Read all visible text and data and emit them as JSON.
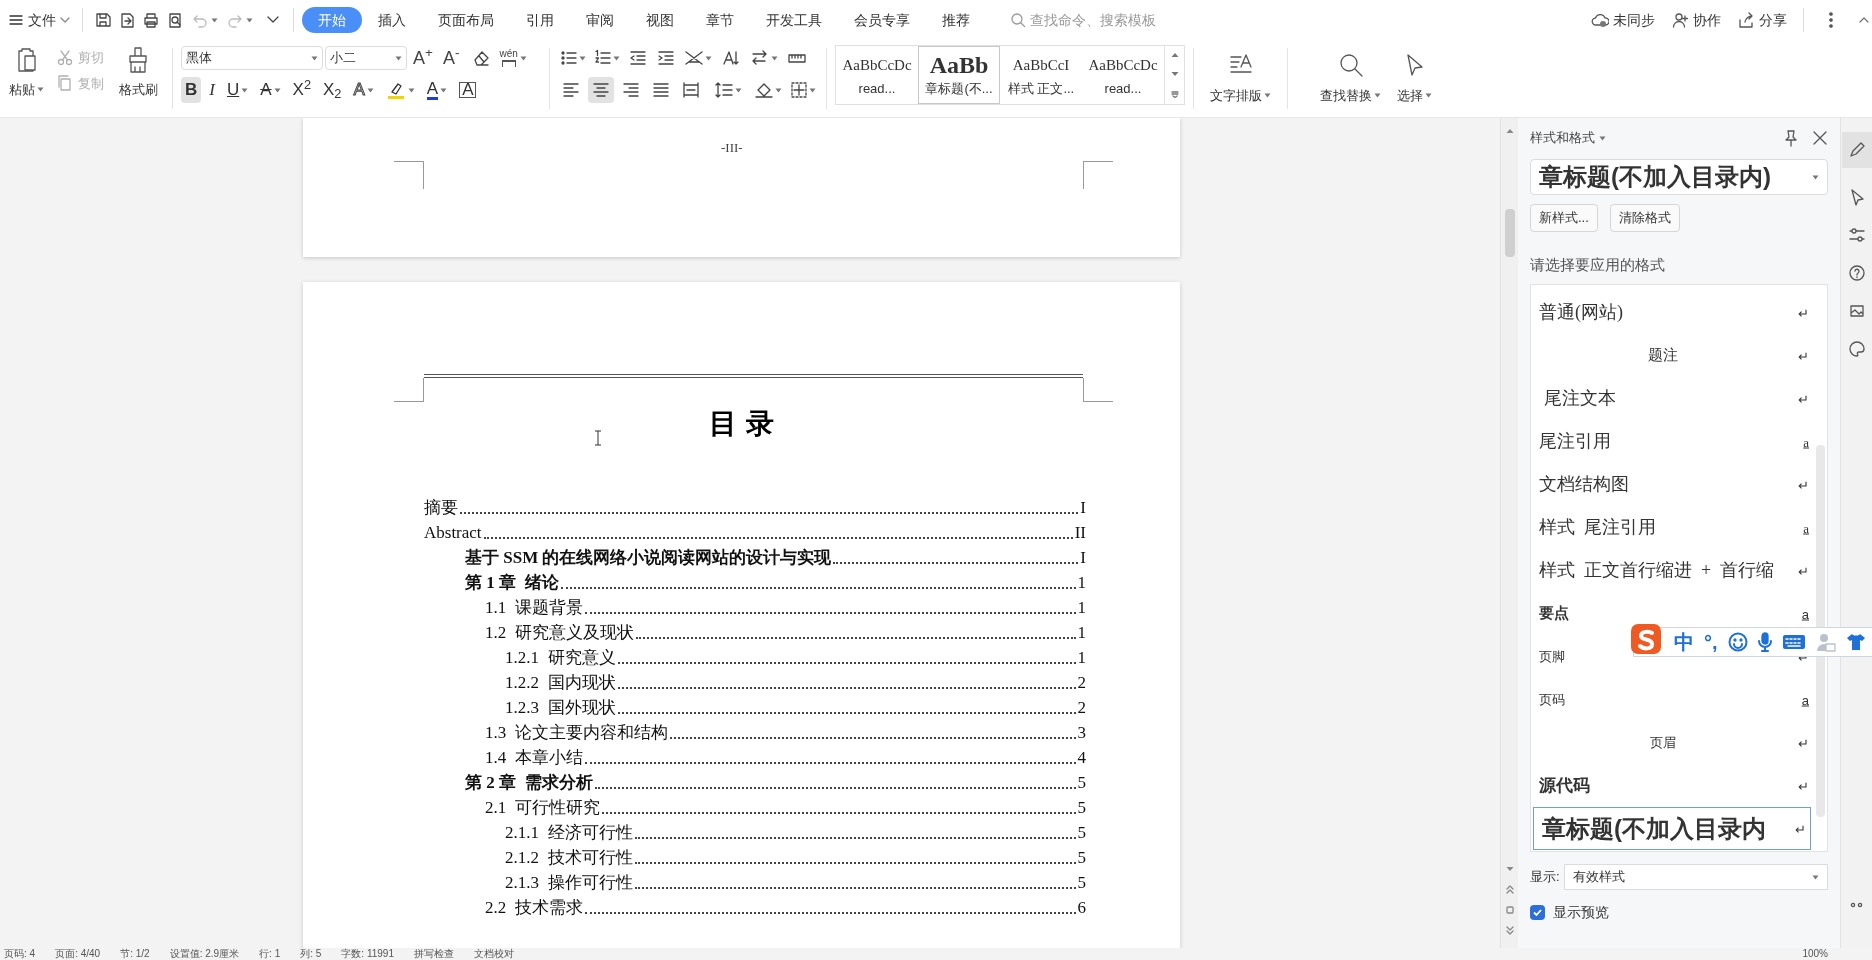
{
  "title_bar": {
    "file_menu": "文件",
    "tabs": [
      {
        "label": "开始",
        "selected": true
      },
      {
        "label": "插入",
        "selected": false
      },
      {
        "label": "页面布局",
        "selected": false
      },
      {
        "label": "引用",
        "selected": false
      },
      {
        "label": "审阅",
        "selected": false
      },
      {
        "label": "视图",
        "selected": false
      },
      {
        "label": "章节",
        "selected": false
      },
      {
        "label": "开发工具",
        "selected": false
      },
      {
        "label": "会员专享",
        "selected": false
      },
      {
        "label": "推荐",
        "selected": false
      }
    ],
    "search": {
      "placeholder": "查找命令、搜索模板"
    },
    "actions": [
      {
        "label": "未同步",
        "kind": "cloud"
      },
      {
        "label": "协作",
        "kind": "user"
      },
      {
        "label": "分享",
        "kind": "share"
      }
    ]
  },
  "ribbon": {
    "paste": "粘贴",
    "cut": {
      "label": "剪切",
      "disabled": true
    },
    "copy": {
      "label": "复制",
      "disabled": true
    },
    "format_painter": "格式刷",
    "font": {
      "name": "黑体",
      "size": "小二"
    },
    "font_tools": [
      {
        "glyph": "A$^{+}$",
        "kind": "grow"
      },
      {
        "glyph": "A$^{-}$",
        "kind": "shrink"
      },
      {
        "kind": "eraser"
      },
      {
        "glyph": "wén",
        "kind": "phonetic"
      }
    ],
    "format_buttons": [
      {
        "glyph": "B",
        "kind": "bold",
        "caret": false,
        "selected": true
      },
      {
        "glyph": "I",
        "kind": "italic",
        "caret": false,
        "selected": false
      },
      {
        "glyph": "U",
        "kind": "underline",
        "caret": true,
        "selected": false
      },
      {
        "glyph": "A",
        "kind": "strike",
        "caret": true,
        "selected": false
      },
      {
        "glyph": "X$^{2}$",
        "kind": "plain",
        "caret": false,
        "selected": false
      },
      {
        "glyph": "X$_{2}$",
        "kind": "plain",
        "caret": false,
        "selected": false
      },
      {
        "glyph": "A",
        "kind": "outline",
        "caret": true,
        "selected": false
      },
      {
        "kind": "highlight",
        "caret": true,
        "selected": false
      },
      {
        "glyph": "A",
        "kind": "color",
        "caret": true,
        "selected": false
      },
      {
        "glyph": "A",
        "kind": "boxed",
        "caret": false,
        "selected": false
      }
    ],
    "align_buttons": [
      {
        "kind": "left",
        "selected": false
      },
      {
        "kind": "center",
        "selected": true
      },
      {
        "kind": "right",
        "selected": false
      },
      {
        "kind": "justify",
        "selected": false
      },
      {
        "kind": "distributed",
        "selected": false
      }
    ],
    "styles": [
      {
        "sample": "AaBbCcDc",
        "name": "read...",
        "kind": "plain",
        "selected": false
      },
      {
        "sample": "AaBb",
        "name": "章标题(不...",
        "kind": "bold",
        "selected": true
      },
      {
        "sample": "AaBbCcI",
        "name": "样式 正文...",
        "kind": "plain",
        "selected": false
      },
      {
        "sample": "AaBbCcDc",
        "name": "read...",
        "kind": "plain",
        "selected": false
      }
    ],
    "tools": [
      {
        "label": "文字排版",
        "kind": "layout"
      },
      {
        "label": "查找替换",
        "kind": "find"
      },
      {
        "label": "选择",
        "kind": "select"
      }
    ]
  },
  "document": {
    "footer": "-III-",
    "heading": "目 录",
    "toc": [
      {
        "text": "摘要",
        "page": "I",
        "kind": "front"
      },
      {
        "text": "Abstract",
        "page": "II",
        "kind": "front"
      },
      {
        "text": "基于 SSM 的在线网络小说阅读网站的设计与实现",
        "page": "I",
        "kind": "heading"
      },
      {
        "text": "第 1 章  绪论",
        "page": "1",
        "kind": "heading",
        "children": [
          {
            "text": "1.1  课题背景",
            "page": "1"
          },
          {
            "text": "1.2  研究意义及现状",
            "page": "1",
            "children": [
              {
                "text": "1.2.1  研究意义",
                "page": "1"
              },
              {
                "text": "1.2.2  国内现状",
                "page": "2"
              },
              {
                "text": "1.2.3  国外现状",
                "page": "2"
              }
            ]
          },
          {
            "text": "1.3  论文主要内容和结构",
            "page": "3"
          },
          {
            "text": "1.4  本章小结",
            "page": "4"
          }
        ]
      },
      {
        "text": "第 2 章  需求分析",
        "page": "5",
        "kind": "heading",
        "children": [
          {
            "text": "2.1  可行性研究",
            "page": "5",
            "children": [
              {
                "text": "2.1.1  经济可行性",
                "page": "5"
              },
              {
                "text": "2.1.2  技术可行性",
                "page": "5"
              },
              {
                "text": "2.1.3  操作可行性",
                "page": "5"
              }
            ]
          },
          {
            "text": "2.2  技术需求",
            "page": "6"
          }
        ]
      }
    ]
  },
  "styles_panel": {
    "title": "样式和格式",
    "current_style": "章标题(不加入目录内)",
    "buttons": [
      "新样式...",
      "清除格式"
    ],
    "prompt": "请选择要应用的格式",
    "styles": [
      {
        "name": "普通(网站)",
        "kind": "body",
        "mark": "↵",
        "character": false,
        "selected": false
      },
      {
        "name": "题注",
        "kind": "centered",
        "mark": "↵",
        "character": false,
        "selected": false
      },
      {
        "name": " 尾注文本",
        "kind": "body",
        "mark": "↵",
        "character": false,
        "selected": false
      },
      {
        "name": "尾注引用",
        "kind": "body",
        "mark": "a",
        "character": true,
        "selected": false
      },
      {
        "name": "文档结构图",
        "kind": "body",
        "mark": "↵",
        "character": false,
        "selected": false
      },
      {
        "name": "样式  尾注引用",
        "kind": "body",
        "mark": "a",
        "character": true,
        "selected": false
      },
      {
        "name": "样式  正文首行缩进  +  首行缩",
        "kind": "body",
        "mark": "↵",
        "character": false,
        "selected": false
      },
      {
        "name": "要点",
        "kind": "strong",
        "mark": "a",
        "character": true,
        "selected": false
      },
      {
        "name": "页脚",
        "kind": "small",
        "mark": "↵",
        "character": false,
        "selected": false
      },
      {
        "name": "页码",
        "kind": "small",
        "mark": "a",
        "character": true,
        "selected": false
      },
      {
        "name": "页眉",
        "kind": "centered-small",
        "mark": "↵",
        "character": false,
        "selected": false
      },
      {
        "name": "源代码",
        "kind": "title",
        "mark": "↵",
        "character": false,
        "selected": false
      },
      {
        "name": "章标题(不加入目录内",
        "kind": "chapter",
        "mark": "↵",
        "character": false,
        "selected": true
      }
    ],
    "display_label": "显示:",
    "display_value": "有效样式",
    "preview": {
      "label": "显示预览",
      "checked": true
    }
  },
  "ime_bar": {
    "labels": [
      "中",
      "°,"
    ]
  },
  "status_bar": {
    "items": [
      "页码: 4",
      "页面: 4/40",
      "节: 1/2",
      "设置值: 2.9厘米",
      "行: 1",
      "列: 5",
      "字数: 11991",
      "拼写检查",
      "文档校对"
    ],
    "zoom": "100%"
  }
}
